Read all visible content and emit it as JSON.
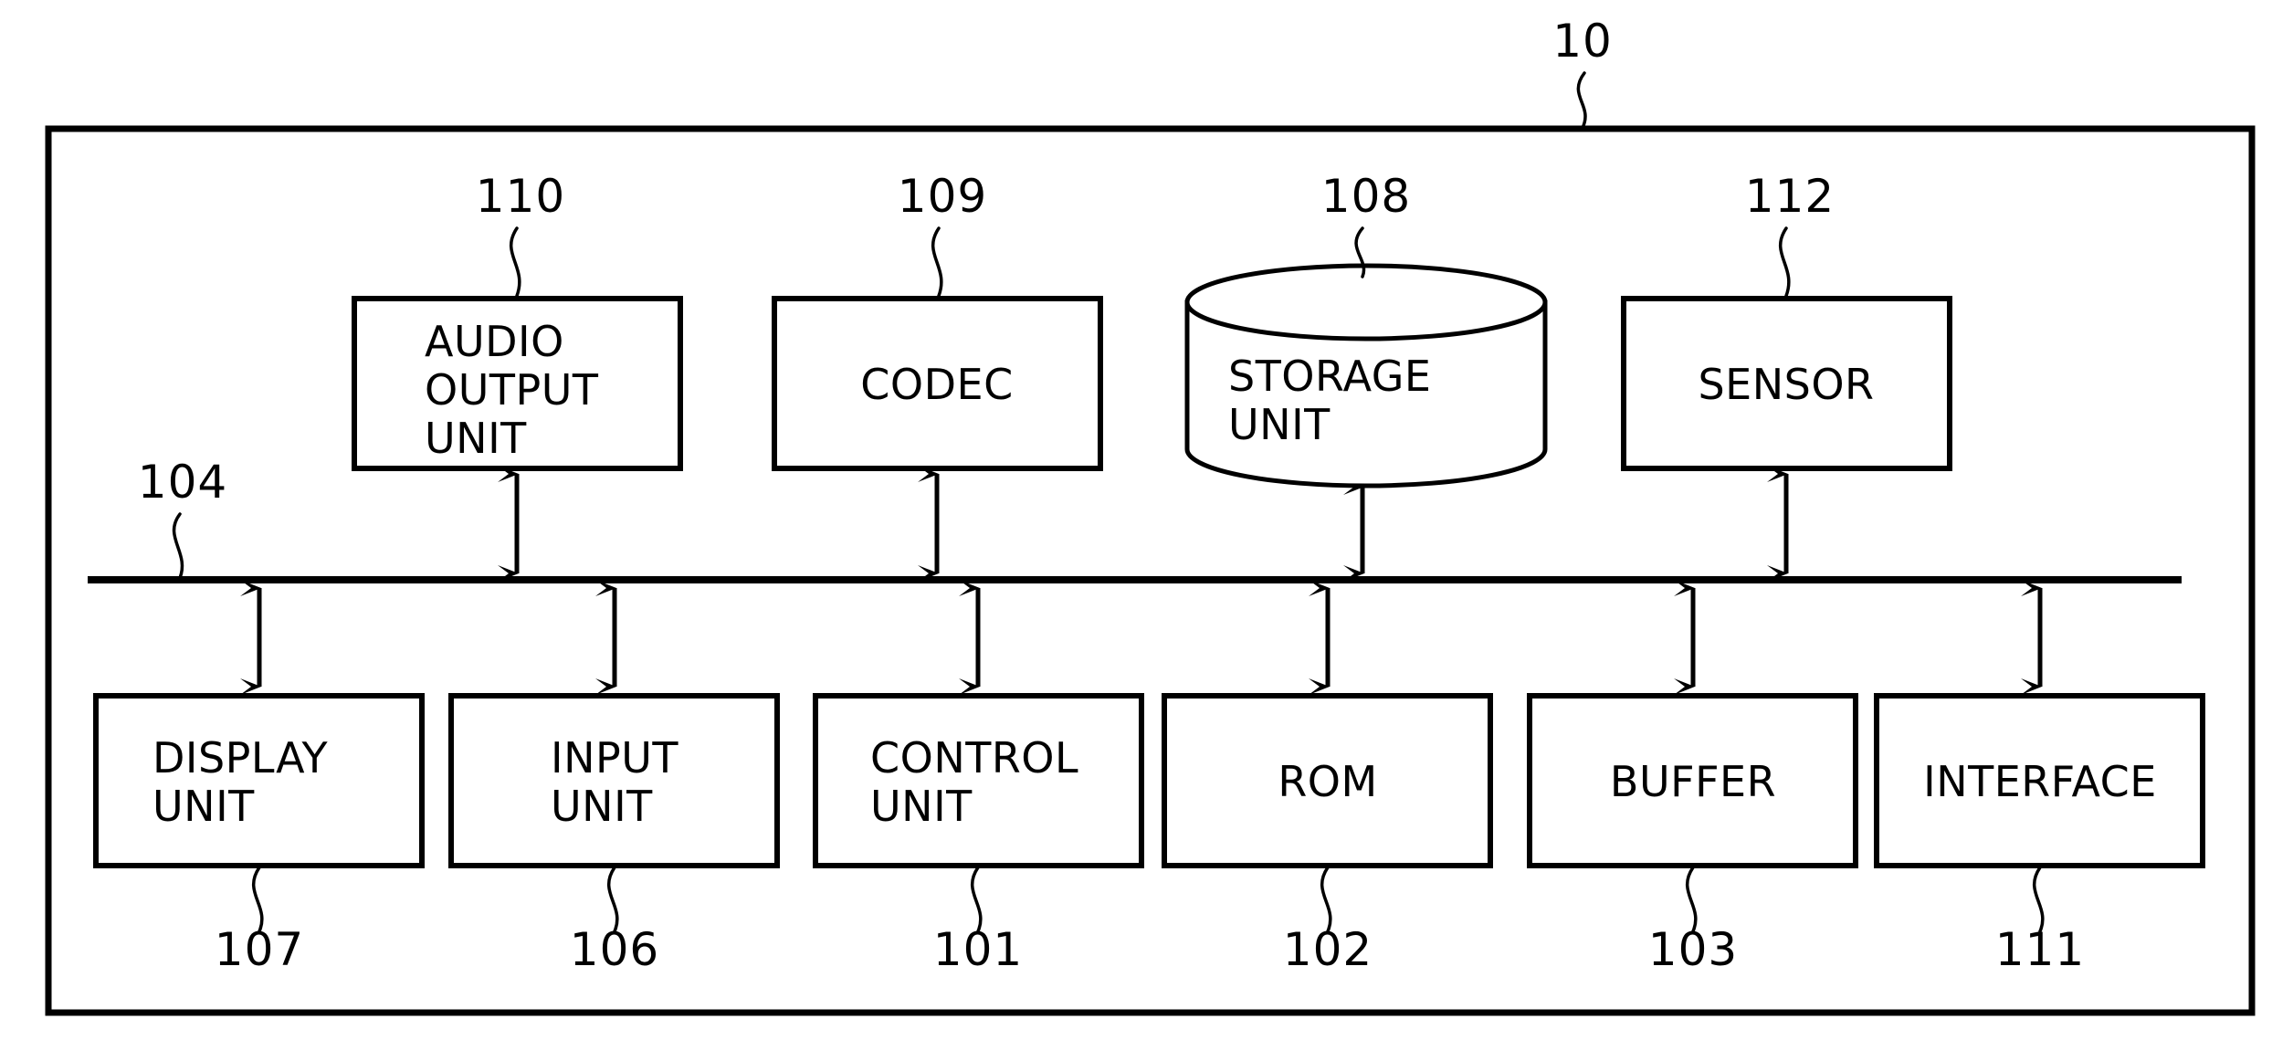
{
  "figure": {
    "type": "patent-block-diagram",
    "description": "Block diagram of an electronic apparatus with a common bus",
    "system_reference_number": "10"
  },
  "outer_frame": {
    "label": "10",
    "name": "apparatus-boundary"
  },
  "bus": {
    "label": "104",
    "name": "system-bus"
  },
  "upper_blocks": [
    {
      "id": "audio-output-unit",
      "label_lines": [
        "AUDIO",
        "OUTPUT",
        "UNIT"
      ],
      "ref": "110",
      "shape": "rectangle",
      "text_align": "left"
    },
    {
      "id": "codec",
      "label_lines": [
        "CODEC"
      ],
      "ref": "109",
      "shape": "rectangle",
      "text_align": "center"
    },
    {
      "id": "storage-unit",
      "label_lines": [
        "STORAGE",
        "UNIT"
      ],
      "ref": "108",
      "shape": "cylinder",
      "text_align": "left"
    },
    {
      "id": "sensor",
      "label_lines": [
        "SENSOR"
      ],
      "ref": "112",
      "shape": "rectangle",
      "text_align": "center"
    }
  ],
  "lower_blocks": [
    {
      "id": "display-unit",
      "label_lines": [
        "DISPLAY",
        "UNIT"
      ],
      "ref": "107",
      "shape": "rectangle",
      "text_align": "left"
    },
    {
      "id": "input-unit",
      "label_lines": [
        "INPUT",
        "UNIT"
      ],
      "ref": "106",
      "shape": "rectangle",
      "text_align": "left"
    },
    {
      "id": "control-unit",
      "label_lines": [
        "CONTROL",
        "UNIT"
      ],
      "ref": "101",
      "shape": "rectangle",
      "text_align": "left"
    },
    {
      "id": "rom",
      "label_lines": [
        "ROM"
      ],
      "ref": "102",
      "shape": "rectangle",
      "text_align": "center"
    },
    {
      "id": "buffer",
      "label_lines": [
        "BUFFER"
      ],
      "ref": "103",
      "shape": "rectangle",
      "text_align": "center"
    },
    {
      "id": "interface",
      "label_lines": [
        "INTERFACE"
      ],
      "ref": "111",
      "shape": "rectangle",
      "text_align": "center"
    }
  ],
  "colors": {
    "ink": "#000000",
    "paper": "#ffffff"
  }
}
